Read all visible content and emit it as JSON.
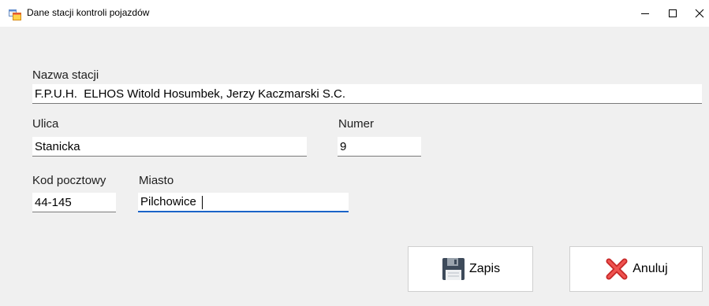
{
  "window": {
    "title": "Dane stacji kontroli pojazdów",
    "controls": {
      "minimize": "—",
      "maximize": "☐",
      "close": "✕"
    },
    "icon": "form-window-icon"
  },
  "form": {
    "station_name": {
      "label": "Nazwa stacji",
      "value": "F.P.U.H.  ELHOS Witold Hosumbek, Jerzy Kaczmarski S.C."
    },
    "street": {
      "label": "Ulica",
      "value": "Stanicka"
    },
    "number": {
      "label": "Numer",
      "value": "9"
    },
    "postal_code": {
      "label": "Kod pocztowy",
      "value": "44-145"
    },
    "city": {
      "label": "Miasto",
      "value": "Pilchowice",
      "focused": true
    }
  },
  "buttons": {
    "save": {
      "label": "Zapis",
      "icon": "floppy-disk-icon"
    },
    "cancel": {
      "label": "Anuluj",
      "icon": "red-x-icon"
    }
  },
  "colors": {
    "background": "#f0f0f0",
    "focus_underline": "#1a64c8",
    "field_underline": "#7a7a7a"
  }
}
